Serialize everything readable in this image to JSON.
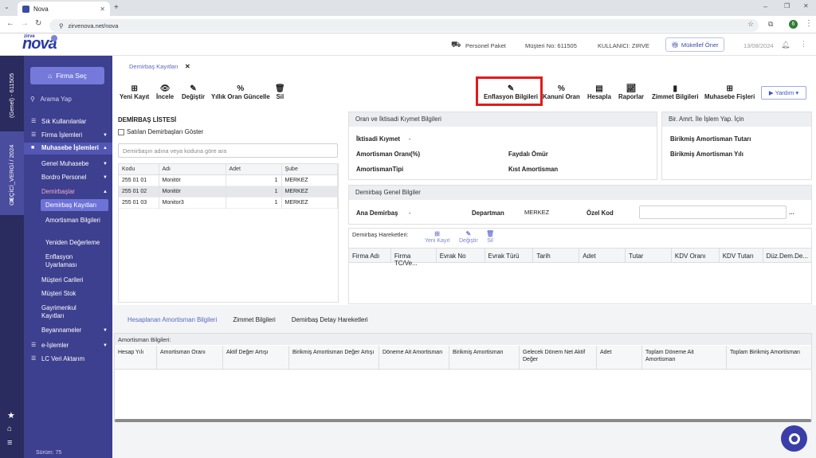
{
  "browser": {
    "tab_title": "Nova",
    "url": "zirvenova.net/nova",
    "profile_initial": "6"
  },
  "header": {
    "logo": "nova",
    "logo_small": "zirve",
    "paket": "Personel Paket",
    "musteri_no": "Müşteri No: 611505",
    "kullanici": "KULLANICI: ZIRVE",
    "mukellef_button": "Mükellef Öner",
    "date": "13/08/2024"
  },
  "rail": {
    "top_text": "(Genel) - 611505",
    "mid_text": "GEÇİCİ_VERGİ / 2024"
  },
  "sidebar": {
    "firma_sec": "Firma Seç",
    "search_placeholder": "Arama Yap",
    "items": [
      {
        "label": "Sık Kullanılanlar"
      },
      {
        "label": "Firma İşlemleri"
      },
      {
        "label": "Muhasebe İşlemleri"
      },
      {
        "label": "Genel Muhasebe"
      },
      {
        "label": "Bordro Personel"
      },
      {
        "label": "Demirbaşlar"
      },
      {
        "label": "Demirbaş Kayıtları"
      },
      {
        "label": "Amortisman Bilgileri"
      },
      {
        "label": "Yeniden Değerleme"
      },
      {
        "label": "Enflasyon Uyarlaması"
      },
      {
        "label": "Müşteri Carileri"
      },
      {
        "label": "Müşteri Stok"
      },
      {
        "label": "Gayrimenkul Kayıtları"
      },
      {
        "label": "Beyannameler"
      },
      {
        "label": "e-İşlemler"
      },
      {
        "label": "LC Veri Aktarım"
      }
    ],
    "version": "Sürüm: 75"
  },
  "breadcrumb": {
    "tab": "Demirbaş Kayıtları"
  },
  "toolbar_left": {
    "yeni": "Yeni Kayıt",
    "incele": "İncele",
    "degistir": "Değiştir",
    "yillik": "Yıllık Oran Güncelle",
    "sil": "Sil"
  },
  "toolbar_right": {
    "enflasyon": "Enflasyon Bilgileri",
    "kanuni": "Kanuni Oran",
    "hesapla": "Hesapla",
    "raporlar": "Raporlar",
    "zimmet": "Zimmet Bilgileri",
    "muhasebe": "Muhasebe Fişleri",
    "yardim": "Yardım"
  },
  "list": {
    "title": "DEMİRBAŞ LİSTESİ",
    "checkbox": "Satılan Demirbaşları Göster",
    "search_placeholder": "Demirbaşın adına veya koduna göre ara",
    "columns": [
      "Kodu",
      "Adı",
      "Adet",
      "Şube"
    ],
    "rows": [
      [
        "255 01 01",
        "Monitör",
        "1",
        "MERKEZ"
      ],
      [
        "255 01 02",
        "Monitör",
        "1",
        "MERKEZ"
      ],
      [
        "255 01 03",
        "Monitor3",
        "1",
        "MERKEZ"
      ]
    ]
  },
  "oran": {
    "title": "Oran ve İktisadi Kıymet Bilgileri",
    "iktisadi": "İktisadi Kıymet",
    "iktisadi_val": "-",
    "oran": "Amortisman Oranı(%)",
    "faydali": "Faydalı Ömür",
    "tipi": "AmortismanTipi",
    "kist": "Kıst Amortisman"
  },
  "birikmis": {
    "title": "Bir. Amrt. İle İşlem Yap. İçin",
    "tutar": "Birikmiş Amortisman Tutarı",
    "yil": "Birikmiş Amortisman Yılı"
  },
  "genel": {
    "title": "Demirbaş Genel Bilgiler",
    "ana": "Ana Demirbaş",
    "ana_val": "-",
    "departman": "Departman",
    "departman_val": "MERKEZ",
    "ozel": "Özel Kod",
    "dots": "..."
  },
  "hareket": {
    "title": "Demirbaş Hareketleri:",
    "yeni": "Yeni Kayıt",
    "degistir": "Değiştir",
    "sil": "Sil",
    "columns": [
      "Firma Adı",
      "Firma TC/Ve...",
      "Evrak No",
      "Evrak Türü",
      "Tarih",
      "Adet",
      "Tutar",
      "KDV Oranı",
      "KDV Tutarı",
      "Düz.Dem.De..."
    ]
  },
  "bottom_tabs": [
    "Hesaplanan Amortisman Bilgileri",
    "Zimmet Bilgileri",
    "Demirbaş Detay Hareketleri"
  ],
  "amortisman": {
    "title": "Amortisman Bilgileri:",
    "columns": [
      "Hesap Yılı",
      "Amortisman Oranı",
      "Aktif Değer Artışı",
      "Birikmiş Amortisman Değer Artışı",
      "Döneme Ait Amortisman",
      "Birikmiş Amortisman",
      "Gelecek Dönem Net Aktif Değer",
      "Adet",
      "Toplam Döneme Ait Amortisman",
      "Toplam Birikmiş Amortisman"
    ]
  },
  "colors": {
    "accent": "#3d3f8f",
    "highlight": "#e21b1b"
  }
}
